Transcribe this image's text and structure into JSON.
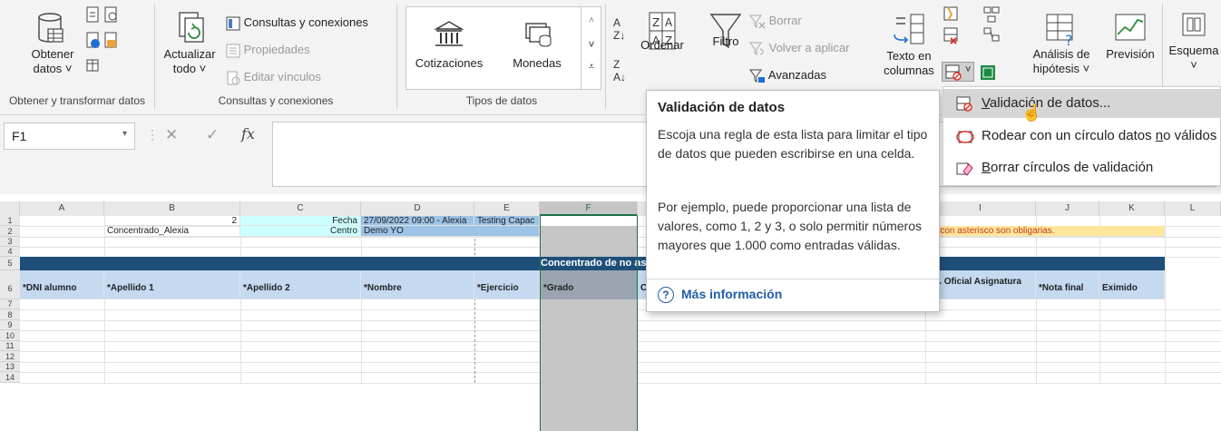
{
  "ribbon": {
    "groups": [
      {
        "label": "Obtener y transformar datos"
      },
      {
        "label": "Consultas y conexiones"
      },
      {
        "label": "Tipos de datos"
      }
    ],
    "obtener_datos": {
      "line1": "Obtener",
      "line2": "datos ˅"
    },
    "actualizar": {
      "line1": "Actualizar",
      "line2": "todo ˅"
    },
    "consultas_conexiones": "Consultas y conexiones",
    "propiedades": "Propiedades",
    "editar_vinculos": "Editar vínculos",
    "cotizaciones": "Cotizaciones",
    "monedas": "Monedas",
    "ordenar": "Ordenar",
    "filtro": "Filtro",
    "borrar": "Borrar",
    "volver_aplicar": "Volver a aplicar",
    "avanzadas": "Avanzadas",
    "texto_columnas": {
      "line1": "Texto en",
      "line2": "columnas"
    },
    "analisis": {
      "line1": "Análisis de",
      "line2": "hipótesis ˅"
    },
    "prevision": "Previsión",
    "esquema": {
      "line1": "Esquema",
      "line2": "˅"
    }
  },
  "formula_bar": {
    "name_box": "F1",
    "cancel_symbol": "✕",
    "enter_symbol": "✓",
    "fx_symbol": "fx"
  },
  "tooltip": {
    "title": "Validación de datos",
    "para1": "Escoja una regla de esta lista para limitar el tipo de datos que pueden escribirse en una celda.",
    "para2": "Por ejemplo, puede proporcionar una lista de valores, como 1, 2 y 3, o solo permitir números mayores que 1.000 como entradas válidas.",
    "more_info": "Más información"
  },
  "menu": {
    "items": [
      {
        "pre": "",
        "ul": "V",
        "post": "alidación de datos..."
      },
      {
        "pre": "Rodear con un círculo datos ",
        "ul": "n",
        "post": "o válidos"
      },
      {
        "pre": "",
        "ul": "B",
        "post": "orrar círculos de validación"
      }
    ]
  },
  "sheet": {
    "columns": [
      "A",
      "B",
      "C",
      "D",
      "E",
      "F",
      "G",
      "H",
      "I",
      "J",
      "K",
      "L"
    ],
    "rows": [
      "1",
      "2",
      "3",
      "4",
      "5",
      "6",
      "7",
      "8",
      "9",
      "10",
      "11",
      "12",
      "13",
      "14"
    ],
    "b1": "2",
    "c1": "Fecha",
    "d1": "27/09/2022 09:00 - Alexia",
    "e1": "Testing Capac",
    "b2": "Concentrado_Alexia",
    "c2": "Centro",
    "d2": "Demo YO",
    "i2": "os con asterisco son obligarias.",
    "row5_title": "Concentrado de no as",
    "headers": {
      "a": "*DNI alumno",
      "b": "*Apellido 1",
      "c": "*Apellido 2",
      "d": "*Nombre",
      "e": "*Ejercicio",
      "f": "*Grado",
      "g": "C",
      "i": "od. Oficial Asignatura",
      "j": "*Nota final",
      "k": "Eximido"
    }
  },
  "colors": {
    "header_navy": "#1f4e79",
    "header_blue": "#c5d9f1",
    "cyan_cell": "#ccffff",
    "d1_blue": "#9dc3e6",
    "selected_col": "#a6a6a6",
    "yellow_note": "#ffe699",
    "link_blue": "#1f5fa8"
  }
}
